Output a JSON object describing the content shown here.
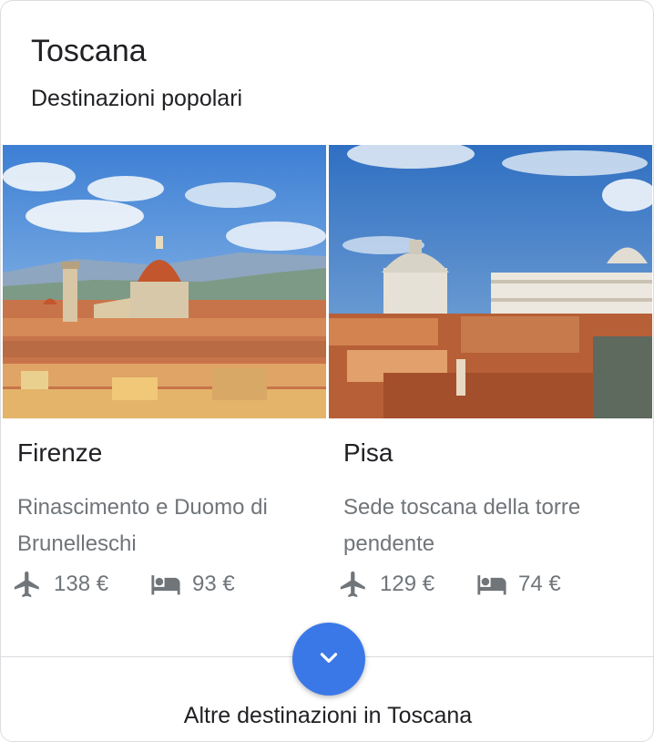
{
  "region": {
    "title": "Toscana",
    "subtitle": "Destinazioni popolari"
  },
  "destinations": [
    {
      "name": "Firenze",
      "description": "Rinascimento e Duomo di Brunelleschi",
      "flight_price": "138 €",
      "hotel_price": "93 €",
      "photo_subject": "Florence skyline with the Duomo and bell tower"
    },
    {
      "name": "Pisa",
      "description": "Sede toscana della torre pendente",
      "flight_price": "129 €",
      "hotel_price": "74 €",
      "photo_subject": "Pisa rooftops with the Baptistery and Cathedral"
    }
  ],
  "footer": {
    "more_label": "Altre destinazioni in Toscana"
  },
  "icons": {
    "flight": "airplane-icon",
    "hotel": "bed-icon",
    "expand": "chevron-down-icon"
  },
  "colors": {
    "accent": "#3b78e7",
    "muted_text": "#70757a",
    "primary_text": "#202124",
    "divider": "#dadce0"
  }
}
